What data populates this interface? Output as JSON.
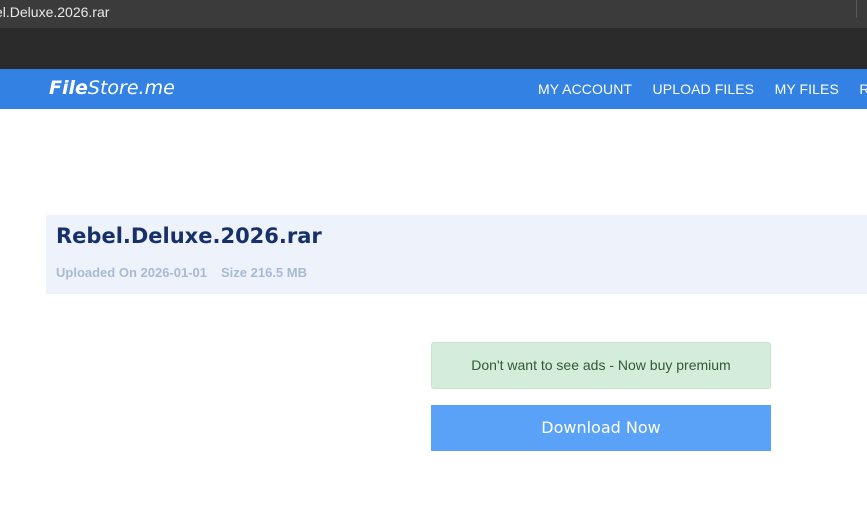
{
  "browser": {
    "window_title": "el.Deluxe.2026.rar"
  },
  "header": {
    "logo_bold": "File",
    "logo_rest": "Store.me",
    "nav": [
      {
        "label": "MY ACCOUNT"
      },
      {
        "label": "UPLOAD FILES"
      },
      {
        "label": "MY FILES"
      },
      {
        "label": "RE"
      }
    ]
  },
  "file": {
    "name": "Rebel.Deluxe.2026.rar",
    "uploaded": "Uploaded On 2026-01-01",
    "size": "Size 216.5 MB"
  },
  "premium": {
    "text": "Don't want to see ads - Now buy premium"
  },
  "download": {
    "label": "Download Now"
  },
  "colors": {
    "header_bg": "#3281e3",
    "panel_bg": "#eef3fb",
    "file_name": "#17306a",
    "premium_bg": "#d4edda",
    "download_bg": "#5aa1f8"
  }
}
